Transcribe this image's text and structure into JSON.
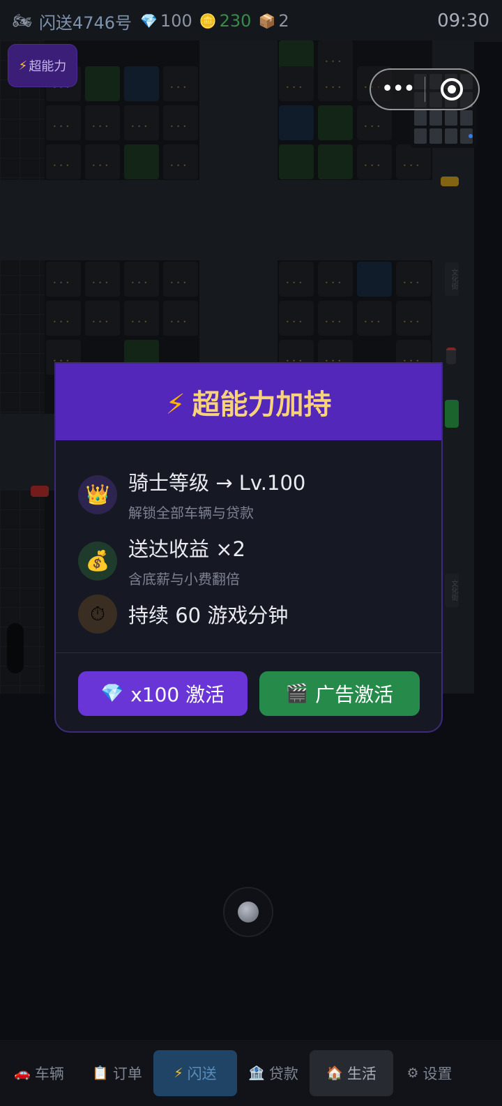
{
  "status_bar": {
    "rider_icon": "motorbike-icon",
    "rider_name": "闪送4746号",
    "diamond_icon": "diamond-icon",
    "diamonds": "100",
    "coin_icon": "coin-icon",
    "coins": "230",
    "package_icon": "package-icon",
    "packages": "2",
    "time": "09:30"
  },
  "superpower_button": {
    "icon": "lightning-icon",
    "label": "超能力"
  },
  "mini_program_capsule": {
    "menu_icon": "more-dots-icon",
    "close_icon": "target-close-icon"
  },
  "map_signs": [
    "文化街",
    "文化街"
  ],
  "modal": {
    "title_icon": "lightning-icon",
    "title": "超能力加持",
    "perks": [
      {
        "icon": "crown-icon",
        "title": "骑士等级 → Lv.100",
        "desc": "解锁全部车辆与贷款"
      },
      {
        "icon": "money-bag-icon",
        "title": "送达收益 ×2",
        "desc": "含底薪与小费翻倍"
      },
      {
        "icon": "stopwatch-icon",
        "title": "持续 60 游戏分钟",
        "desc": ""
      }
    ],
    "buttons": {
      "diamond_icon": "diamond-icon",
      "diamond_label": "x100 激活",
      "ad_icon": "clapperboard-icon",
      "ad_label": "广告激活"
    }
  },
  "bottom_nav": [
    {
      "icon": "car-icon",
      "label": "车辆"
    },
    {
      "icon": "clipboard-icon",
      "label": "订单"
    },
    {
      "icon": "lightning-icon",
      "label": "闪送",
      "active": true
    },
    {
      "icon": "bank-icon",
      "label": "贷款"
    },
    {
      "icon": "house-icon",
      "label": "生活"
    },
    {
      "icon": "gear-icon",
      "label": "设置"
    }
  ],
  "colors": {
    "modal_header": "#5227b9",
    "modal_title": "#f7d27b",
    "diamond_button": "#6a35d6",
    "ad_button": "#268a4a",
    "nav_active": "#1f4466"
  }
}
